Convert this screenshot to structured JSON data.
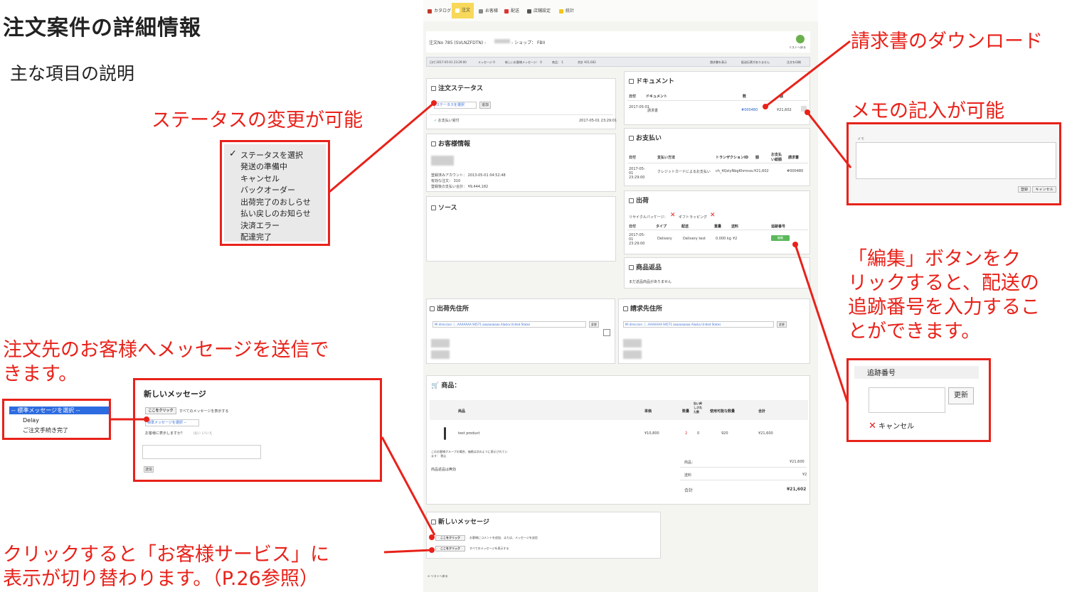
{
  "slide": {
    "title": "注文案件の詳細情報",
    "subtitle": "主な項目の説明"
  },
  "callouts": {
    "status": "ステータスの変更が可能",
    "invoice": "請求書のダウンロード",
    "memo": "メモの記入が可能",
    "edit": [
      "「編集」ボタンをク",
      "リックすると、配送の",
      "追跡番号を入力するこ",
      "とができます。"
    ],
    "message": [
      "注文先のお客様へメッセージを送信で",
      "きます。"
    ],
    "click": [
      "クリックすると「お客様サービス」に",
      "表示が切り替わります。（P.26参照）"
    ]
  },
  "status_menu": {
    "items": [
      "ステータスを選択",
      "発送の準備中",
      "キャンセル",
      "バックオーダー",
      "出荷完了のおしらせ",
      "払い戻しのお知らせ",
      "決済エラー",
      "配達完了"
    ],
    "checkmark": "✓"
  },
  "template_menu": {
    "items": [
      "-- 標準メッセージを選択 --",
      "Delay",
      "ご注文手続き完了"
    ]
  },
  "message_panel": {
    "title": "新しいメッセージ",
    "click_button": "ここをクリック",
    "click_hint": "すべてのメッセージを表示する",
    "select_placeholder": "標準メッセージを選択 --",
    "show_label": "お客様に表示しますか？",
    "show_options": "はい  いいえ",
    "send_button": "送信"
  },
  "memo_panel": {
    "label": "メモ",
    "save_button": "登録",
    "cancel_button": "キャンセル"
  },
  "tracking_panel": {
    "title": "追跡番号",
    "update_button": "更新",
    "cancel_label": "キャンセル"
  },
  "app": {
    "nav": [
      "カタログ",
      "注文",
      "お客様",
      "配送",
      "店舗設定",
      "統計"
    ],
    "order_title": "注文No 785 (SVLNZFDTN) -",
    "shop_label": "- ショップ： FBII",
    "back_label": "リストへ戻る",
    "info_bar": {
      "date": "日付 2017-05-01 23:29:00",
      "messages": "メッセージ 0",
      "new_messages": "新しいお客様メッセージ： 0",
      "products": "商品： 1",
      "total": "合計 ¥21,602",
      "actions": [
        "請求書を表示",
        "配送伝票がありません",
        "注文を印刷"
      ]
    },
    "status_card": {
      "title": "注文ステータス",
      "select": "ステータスを選択",
      "add_button": "追加",
      "history_label": "お支払い受付",
      "history_date": "2017-05-01 23:29:01"
    },
    "customer_card": {
      "title": "お客様情報",
      "registered": "登録済みアカウント： 2013-05-01 04:52:48",
      "valid_orders": "有効な注文： 310",
      "total_spent": "登録後の支払い合計： ¥9,444,182"
    },
    "source_card": {
      "title": "ソース"
    },
    "document_card": {
      "title": "ドキュメント",
      "headers": [
        "日付",
        "ドキュメント",
        "数",
        "額"
      ],
      "row": [
        "2017-05-01",
        "請求書",
        "#000480",
        "¥21,602"
      ]
    },
    "payment_card": {
      "title": "お支払い",
      "headers": [
        "日付",
        "支払い方法",
        "トランザクションID",
        "額",
        "お支払い総額",
        "請求書"
      ],
      "row": [
        "2017-05-01 23:29:00",
        "クレジットカードによるお支払い",
        "ch_4QziyNbgKhmnxu",
        "¥21,602",
        "",
        "#000480"
      ]
    },
    "shipping_card": {
      "title": "出荷",
      "recycle": "リサイクルパッケージ：",
      "gift": "ギフトラッピング",
      "headers": [
        "日付",
        "タイプ",
        "配送",
        "重量",
        "送料",
        "追跡番号"
      ],
      "row": [
        "2017-05-01 23:29:00",
        "Delivery",
        "Delivery test",
        "0.000 kg",
        "¥2"
      ],
      "edit_button": "編集"
    },
    "return_card": {
      "title": "商品返品",
      "empty": "まだ返品商品がありません"
    },
    "ship_address": {
      "title": "出荷先住所",
      "select": "Mi direccion（…AAAAAAA 94571 aaaaaaaaaa Alaska United States",
      "change_button": "変更"
    },
    "bill_address": {
      "title": "請求先住所",
      "select": "Mi direccion（…AAAAAAA 94571 aaaaaaaaaa Alaska United States",
      "change_button": "変更"
    },
    "products_card": {
      "title": "商品：",
      "headers": [
        "商品",
        "単価",
        "数量",
        "払い戻しされた数",
        "使用可能な数量",
        "合計"
      ],
      "row": [
        "test product",
        "¥10,800",
        "2",
        "0",
        "920",
        "¥21,600"
      ],
      "note": "このお客様グループの場合、価格は次のように表示されています： 税込",
      "no_return": "商品返品は無効",
      "totals": [
        {
          "label": "商品：",
          "value": "¥21,600"
        },
        {
          "label": "送料",
          "value": "¥2"
        },
        {
          "label": "合計",
          "value": "¥21,602"
        }
      ]
    },
    "message_card": {
      "title": "新しいメッセージ",
      "btn1": "ここをクリック",
      "hint1": "お客様にコメントを追加、または、メッセージを送信",
      "btn2": "ここをクリック",
      "hint2": "すべてのメッセージを表示する"
    },
    "back_footer": "リストへ戻る"
  },
  "colors": {
    "callout_red": "#e8221a",
    "nav_active": "#f7d85a",
    "edit_green": "#5cb85c"
  }
}
